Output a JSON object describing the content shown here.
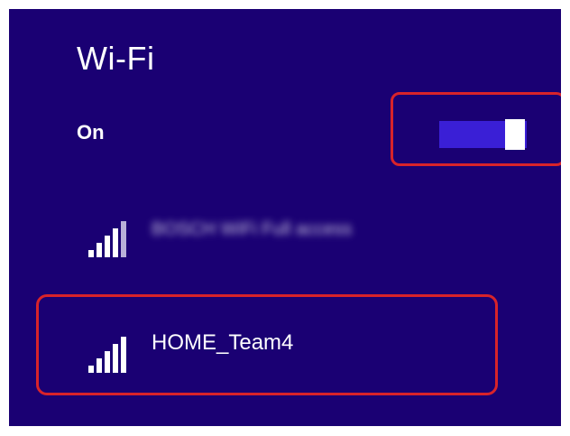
{
  "panel": {
    "title": "Wi-Fi",
    "toggle": {
      "label": "On",
      "state": "on"
    },
    "accent_color": "#1a0073",
    "highlight_color": "#d8232a"
  },
  "networks": [
    {
      "name": "BOSCH WiFi Full access",
      "signal_icon": "signal-bars-icon",
      "blurred": true
    },
    {
      "name": "HOME_Team4",
      "signal_icon": "signal-bars-icon",
      "highlighted": true
    }
  ]
}
